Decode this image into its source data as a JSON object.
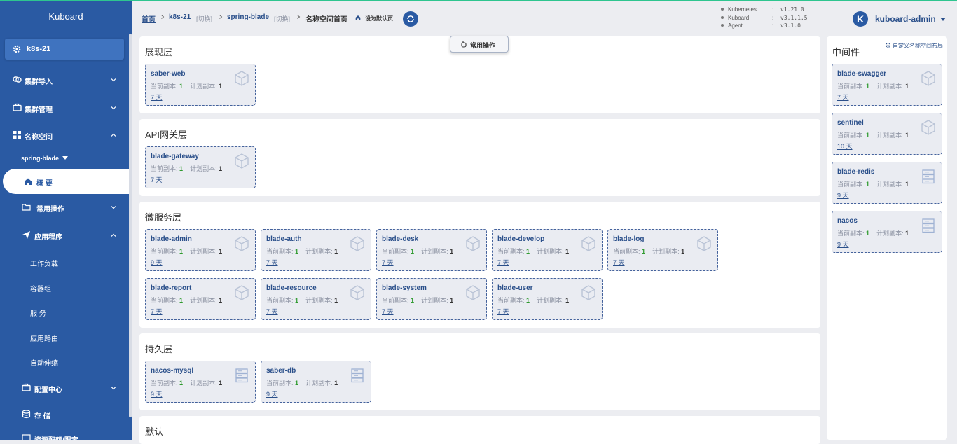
{
  "sidebar": {
    "title": "Kuboard",
    "cluster": "k8s-21",
    "menu": {
      "import": "集群导入",
      "manage": "集群管理",
      "namespace": "名称空间",
      "ns_selected": "spring-blade",
      "overview": "概 要",
      "common_ops": "常用操作",
      "apps": "应用程序",
      "workload": "工作负载",
      "pods": "容器组",
      "services": "服 务",
      "routes": "应用路由",
      "autoscale": "自动伸缩",
      "config": "配置中心",
      "storage": "存 储",
      "quota": "资源配额/限定"
    }
  },
  "header": {
    "home": "首页",
    "cluster": "k8s-21",
    "switch1": "[切换]",
    "namespace": "spring-blade",
    "switch2": "[切换]",
    "page": "名称空间首页",
    "set_default": "设为默认页",
    "versions": [
      {
        "name": "Kubernetes",
        "value": "v1.21.0"
      },
      {
        "name": "Kuboard",
        "value": "v3.1.1.5"
      },
      {
        "name": "Agent",
        "value": "v3.1.0"
      }
    ],
    "user_initial": "K",
    "user": "kuboard-admin",
    "sep": ":"
  },
  "ops_button": "常用操作",
  "labels": {
    "current": "当前副本:",
    "planned": "计划副本:"
  },
  "layers": [
    {
      "title": "展现层",
      "items": [
        {
          "name": "saber-web",
          "current": "1",
          "planned": "1",
          "age": "7 天",
          "icon": "cube-icon"
        }
      ]
    },
    {
      "title": "API网关层",
      "items": [
        {
          "name": "blade-gateway",
          "current": "1",
          "planned": "1",
          "age": "7 天",
          "icon": "cube-icon"
        }
      ]
    },
    {
      "title": "微服务层",
      "items": [
        {
          "name": "blade-admin",
          "current": "1",
          "planned": "1",
          "age": "9 天",
          "icon": "cube-icon"
        },
        {
          "name": "blade-auth",
          "current": "1",
          "planned": "1",
          "age": "7 天",
          "icon": "cube-icon"
        },
        {
          "name": "blade-desk",
          "current": "1",
          "planned": "1",
          "age": "7 天",
          "icon": "cube-icon"
        },
        {
          "name": "blade-develop",
          "current": "1",
          "planned": "1",
          "age": "7 天",
          "icon": "cube-icon"
        },
        {
          "name": "blade-log",
          "current": "1",
          "planned": "1",
          "age": "7 天",
          "icon": "cube-icon"
        },
        {
          "name": "blade-report",
          "current": "1",
          "planned": "1",
          "age": "7 天",
          "icon": "cube-icon"
        },
        {
          "name": "blade-resource",
          "current": "1",
          "planned": "1",
          "age": "7 天",
          "icon": "cube-icon"
        },
        {
          "name": "blade-system",
          "current": "1",
          "planned": "1",
          "age": "7 天",
          "icon": "cube-icon"
        },
        {
          "name": "blade-user",
          "current": "1",
          "planned": "1",
          "age": "7 天",
          "icon": "cube-icon"
        }
      ]
    },
    {
      "title": "持久层",
      "items": [
        {
          "name": "nacos-mysql",
          "current": "1",
          "planned": "1",
          "age": "9 天",
          "icon": "server-icon"
        },
        {
          "name": "saber-db",
          "current": "1",
          "planned": "1",
          "age": "9 天",
          "icon": "server-icon"
        }
      ]
    },
    {
      "title": "默认",
      "items": []
    }
  ],
  "middleware": {
    "title": "中间件",
    "link": "自定义名称空间布局",
    "items": [
      {
        "name": "blade-swagger",
        "current": "1",
        "planned": "1",
        "age": "7 天",
        "icon": "cube-icon"
      },
      {
        "name": "sentinel",
        "current": "1",
        "planned": "1",
        "age": "10 天",
        "icon": "cube-icon"
      },
      {
        "name": "blade-redis",
        "current": "1",
        "planned": "1",
        "age": "9 天",
        "icon": "server-icon"
      },
      {
        "name": "nacos",
        "current": "1",
        "planned": "1",
        "age": "9 天",
        "icon": "server-icon"
      }
    ]
  },
  "colors": {
    "sidebar": "#2a5aa3",
    "accent": "#2ec58f",
    "running": "#2f9a2f"
  }
}
